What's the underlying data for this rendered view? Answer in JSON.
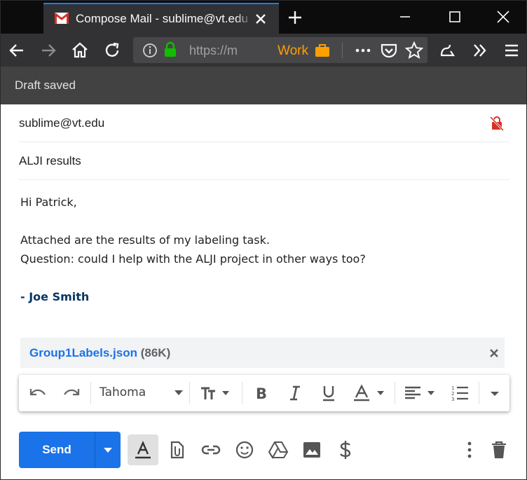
{
  "browser": {
    "tab_title": "Compose Mail - sublime@vt.edu",
    "url_text": "https://m",
    "container_label": "Work"
  },
  "status": {
    "text": "Draft saved"
  },
  "compose": {
    "to": "sublime@vt.edu",
    "subject": "ALJI results",
    "body_lines": [
      "Hi Patrick,",
      "",
      "Attached are the results of my labeling task.",
      "Question: could I help with the ALJI project in other ways too?",
      ""
    ],
    "signature": "- Joe Smith",
    "attachment": {
      "name": "Group1Labels.json",
      "size": "(86K)"
    }
  },
  "toolbar": {
    "font": "Tahoma",
    "send_label": "Send"
  },
  "colors": {
    "send_blue": "#1a73e8",
    "signature_blue": "#073763",
    "container_orange": "#ff9f00"
  }
}
